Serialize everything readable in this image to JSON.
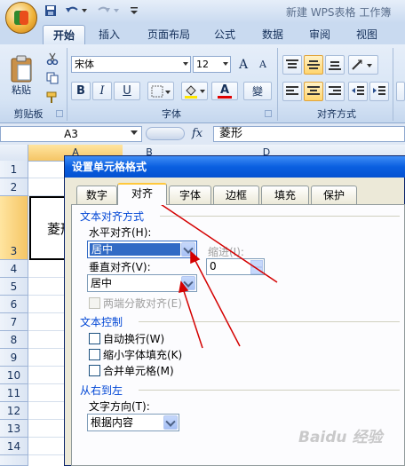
{
  "title_bar": {
    "text": "新建 WPS表格 工作簿"
  },
  "ribbon_tabs": [
    "开始",
    "插入",
    "页面布局",
    "公式",
    "数据",
    "审阅",
    "视图"
  ],
  "clipboard_group": {
    "paste_label": "粘贴",
    "group_label": "剪贴板"
  },
  "font_group": {
    "font_name": "宋体",
    "font_size": "12",
    "grow_label": "A",
    "shrink_label": "A",
    "bold_label": "B",
    "italic_label": "I",
    "underline_label": "U",
    "font_color_label": "A",
    "phonetic_label": "變",
    "group_label": "字体"
  },
  "alignment_group": {
    "group_label": "对齐方式"
  },
  "formula_bar": {
    "name_box": "A3",
    "fx_label": "fx",
    "formula": "菱形"
  },
  "columns": [
    "A",
    "B",
    "D"
  ],
  "rows": [
    "1",
    "2",
    "3",
    "4",
    "5",
    "6",
    "7",
    "8",
    "9",
    "10",
    "11",
    "12",
    "13",
    "14"
  ],
  "cell_a3": "菱形",
  "dialog": {
    "title": "设置单元格格式",
    "tabs": [
      "数字",
      "对齐",
      "字体",
      "边框",
      "填充",
      "保护"
    ],
    "text_alignment": {
      "section": "文本对齐方式",
      "horizontal_label": "水平对齐(H):",
      "horizontal_value": "居中",
      "indent_label": "缩进(I):",
      "indent_value": "0",
      "vertical_label": "垂直对齐(V):",
      "vertical_value": "居中",
      "distributed_label": "两端分散对齐(E)"
    },
    "text_control": {
      "section": "文本控制",
      "wrap_label": "自动换行(W)",
      "shrink_label": "缩小字体填充(K)",
      "merge_label": "合并单元格(M)"
    },
    "rtl": {
      "section": "从右到左",
      "direction_label": "文字方向(T):",
      "direction_value": "根据内容"
    }
  },
  "watermark": "Baidu 经验",
  "colors": {
    "arrow": "#d40000",
    "dialog_title": "#0a5fe0",
    "section_text": "#0046d5"
  }
}
